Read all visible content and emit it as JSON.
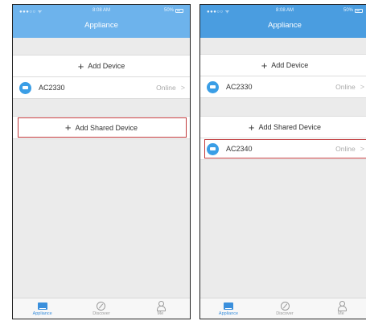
{
  "status_bar": {
    "signal": "●●●○○ ᯤ",
    "time": "8:08 AM",
    "battery": "50%"
  },
  "screen1": {
    "title": "Appliance",
    "add_device_label": "Add Device",
    "device": {
      "name": "AC2330",
      "status": "Online",
      "chevron": ">"
    },
    "add_shared_label": "Add Shared Device"
  },
  "screen2": {
    "title": "Appliance",
    "add_device_label": "Add Device",
    "device1": {
      "name": "AC2330",
      "status": "Online",
      "chevron": ">"
    },
    "add_shared_label": "Add Shared Device",
    "device2": {
      "name": "AC2340",
      "status": "Online",
      "chevron": ">"
    }
  },
  "tabbar": {
    "appliance": "Appliance",
    "discover": "Discover",
    "me": "Me"
  },
  "colors": {
    "header_left": "#6db3ec",
    "header_right": "#4a9de0",
    "accent": "#3a9ee6",
    "highlight": "#c0393b"
  }
}
